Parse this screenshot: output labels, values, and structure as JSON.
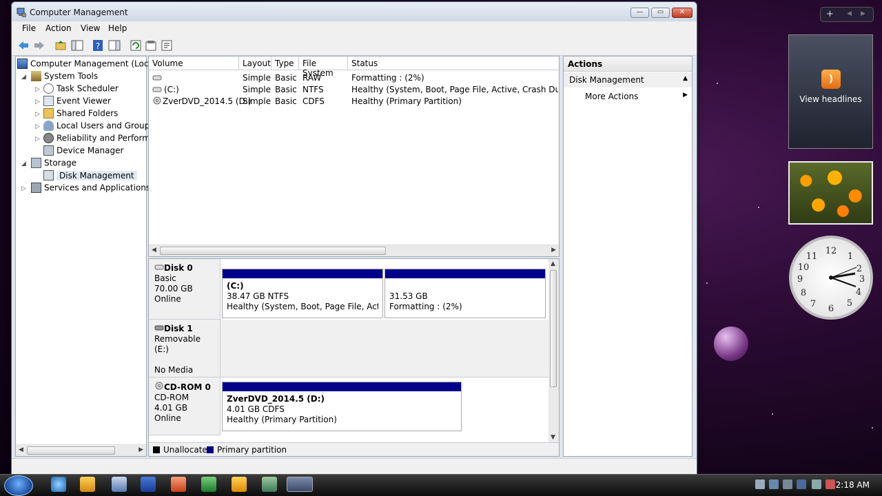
{
  "window": {
    "title": "Computer Management"
  },
  "menu": [
    "File",
    "Action",
    "View",
    "Help"
  ],
  "tree": {
    "root": "Computer Management (Local",
    "system_tools": "System Tools",
    "task_scheduler": "Task Scheduler",
    "event_viewer": "Event Viewer",
    "shared_folders": "Shared Folders",
    "local_users": "Local Users and Groups",
    "reliability": "Reliability and Performa",
    "device_manager": "Device Manager",
    "storage": "Storage",
    "disk_management": "Disk Management",
    "services": "Services and Applications"
  },
  "volumes": {
    "columns": [
      "Volume",
      "Layout",
      "Type",
      "File System",
      "Status"
    ],
    "rows": [
      {
        "volume": "",
        "layout": "Simple",
        "type": "Basic",
        "fs": "RAW",
        "status": "Formatting : (2%)"
      },
      {
        "volume": "(C:)",
        "layout": "Simple",
        "type": "Basic",
        "fs": "NTFS",
        "status": "Healthy (System, Boot, Page File, Active, Crash Dump, Pri"
      },
      {
        "volume": "ZverDVD_2014.5 (D:)",
        "layout": "Simple",
        "type": "Basic",
        "fs": "CDFS",
        "status": "Healthy (Primary Partition)"
      }
    ]
  },
  "disks": {
    "disk0": {
      "name": "Disk 0",
      "kind": "Basic",
      "size": "70.00 GB",
      "state": "Online",
      "p1": {
        "label": "(C:)",
        "size": "38.47 GB NTFS",
        "status": "Healthy (System, Boot, Page File, Active, C"
      },
      "p2": {
        "size": "31.53 GB",
        "status": "Formatting : (2%)"
      }
    },
    "disk1": {
      "name": "Disk 1",
      "kind": "Removable (E:)",
      "state": "No Media"
    },
    "cdrom0": {
      "name": "CD-ROM 0",
      "kind": "CD-ROM",
      "size": "4.01 GB",
      "state": "Online",
      "p1": {
        "label": "ZverDVD_2014.5  (D:)",
        "size": "4.01 GB CDFS",
        "status": "Healthy (Primary Partition)"
      }
    }
  },
  "legend": {
    "unallocated": "Unallocated",
    "primary": "Primary partition"
  },
  "actions": {
    "header": "Actions",
    "section": "Disk Management",
    "more": "More Actions"
  },
  "gadgets": {
    "feed_text": "View headlines",
    "rss_glyph": ")"
  },
  "taskbar": {
    "time": "2:18 AM"
  },
  "colors": {
    "primary_partition": "#00008b",
    "unallocated": "#000000"
  }
}
